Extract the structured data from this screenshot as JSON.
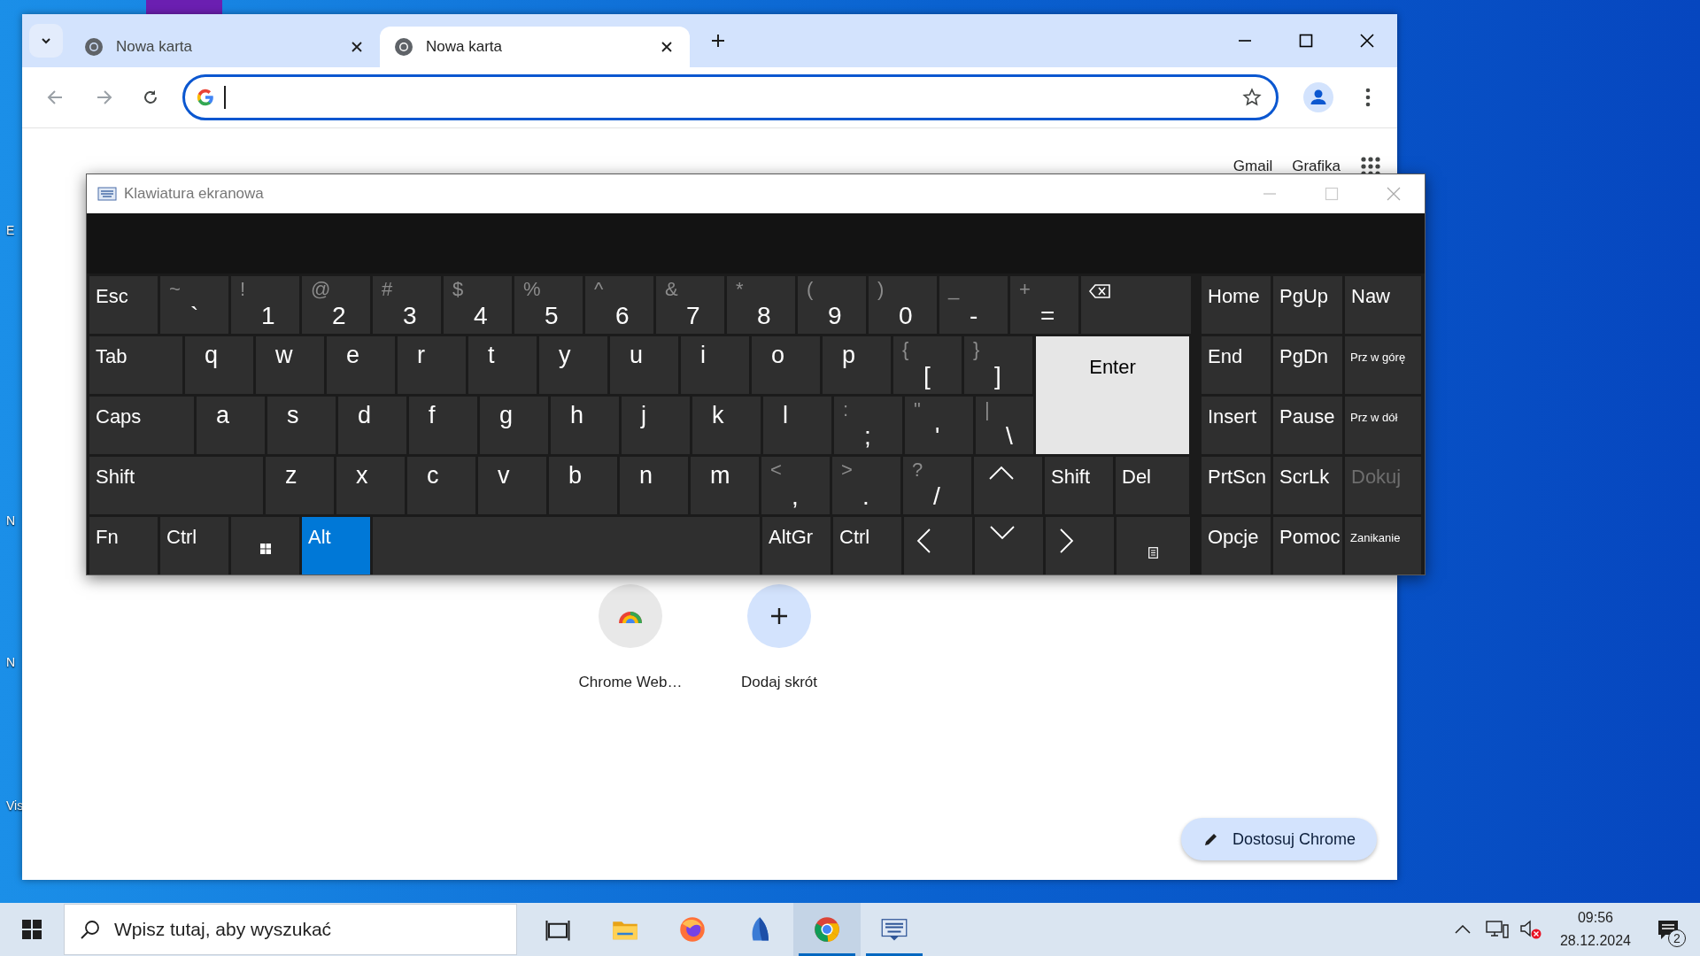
{
  "desktop": {
    "icons": [
      {
        "label": "E"
      },
      {
        "label": "N"
      },
      {
        "label": "N"
      },
      {
        "label": "Vis"
      }
    ]
  },
  "browser": {
    "tabs": [
      {
        "title": "Nowa karta",
        "selected": false
      },
      {
        "title": "Nowa karta",
        "selected": true
      }
    ],
    "header_links": [
      "Gmail",
      "Grafika"
    ],
    "shortcuts": [
      {
        "kind": "site",
        "label": "Chrome Web…"
      },
      {
        "kind": "add",
        "label": "Dodaj skrót"
      }
    ],
    "customize_button": "Dostosuj Chrome"
  },
  "keyboard": {
    "title": "Klawiatura ekranowa",
    "rows": [
      {
        "keys": [
          {
            "kind": "word",
            "label": "Esc",
            "selected": false
          },
          {
            "kind": "char",
            "shift": "~",
            "label": "`",
            "selected": false
          },
          {
            "kind": "char",
            "shift": "!",
            "label": "1",
            "selected": false
          },
          {
            "kind": "char",
            "shift": "@",
            "label": "2",
            "selected": false
          },
          {
            "kind": "char",
            "shift": "#",
            "label": "3",
            "selected": false
          },
          {
            "kind": "char",
            "shift": "$",
            "label": "4",
            "selected": false
          },
          {
            "kind": "char",
            "shift": "%",
            "label": "5",
            "selected": false
          },
          {
            "kind": "char",
            "shift": "^",
            "label": "6",
            "selected": false
          },
          {
            "kind": "char",
            "shift": "&",
            "label": "7",
            "selected": false
          },
          {
            "kind": "char",
            "shift": "*",
            "label": "8",
            "selected": false
          },
          {
            "kind": "char",
            "shift": "(",
            "label": "9",
            "selected": false
          },
          {
            "kind": "char",
            "shift": ")",
            "label": "0",
            "selected": false
          },
          {
            "kind": "char",
            "shift": "_",
            "label": "-",
            "selected": false
          },
          {
            "kind": "char",
            "shift": "+",
            "label": "=",
            "selected": false
          },
          {
            "kind": "backspace",
            "selected": false
          }
        ]
      },
      {
        "keys": [
          {
            "kind": "word",
            "label": "Tab",
            "selected": false
          },
          {
            "kind": "char",
            "label": "q",
            "selected": false
          },
          {
            "kind": "char",
            "label": "w",
            "selected": false
          },
          {
            "kind": "char",
            "label": "e",
            "selected": false
          },
          {
            "kind": "char",
            "label": "r",
            "selected": false
          },
          {
            "kind": "char",
            "label": "t",
            "selected": false
          },
          {
            "kind": "char",
            "label": "y",
            "selected": false
          },
          {
            "kind": "char",
            "label": "u",
            "selected": false
          },
          {
            "kind": "char",
            "label": "i",
            "selected": false
          },
          {
            "kind": "char",
            "label": "o",
            "selected": false
          },
          {
            "kind": "char",
            "label": "p",
            "selected": false
          },
          {
            "kind": "char",
            "shift": "{",
            "label": "[",
            "selected": false
          },
          {
            "kind": "char",
            "shift": "}",
            "label": "]",
            "selected": false
          },
          {
            "kind": "enter",
            "label": "Enter",
            "selected": true
          }
        ]
      },
      {
        "keys": [
          {
            "kind": "word",
            "label": "Caps",
            "selected": false
          },
          {
            "kind": "char",
            "label": "a",
            "selected": false
          },
          {
            "kind": "char",
            "label": "s",
            "selected": false
          },
          {
            "kind": "char",
            "label": "d",
            "selected": false
          },
          {
            "kind": "char",
            "label": "f",
            "selected": false
          },
          {
            "kind": "char",
            "label": "g",
            "selected": false
          },
          {
            "kind": "char",
            "label": "h",
            "selected": false
          },
          {
            "kind": "char",
            "label": "j",
            "selected": false
          },
          {
            "kind": "char",
            "label": "k",
            "selected": false
          },
          {
            "kind": "char",
            "label": "l",
            "selected": false
          },
          {
            "kind": "char",
            "shift": ":",
            "label": ";",
            "selected": false
          },
          {
            "kind": "char",
            "shift": "\"",
            "label": "'",
            "selected": false
          },
          {
            "kind": "char",
            "shift": "|",
            "label": "\\",
            "selected": false
          }
        ]
      },
      {
        "keys": [
          {
            "kind": "word",
            "label": "Shift",
            "selected": false
          },
          {
            "kind": "char",
            "label": "z",
            "selected": false
          },
          {
            "kind": "char",
            "label": "x",
            "selected": false
          },
          {
            "kind": "char",
            "label": "c",
            "selected": false
          },
          {
            "kind": "char",
            "label": "v",
            "selected": false
          },
          {
            "kind": "char",
            "label": "b",
            "selected": false
          },
          {
            "kind": "char",
            "label": "n",
            "selected": false
          },
          {
            "kind": "char",
            "label": "m",
            "selected": false
          },
          {
            "kind": "char",
            "shift": "<",
            "label": ",",
            "selected": false
          },
          {
            "kind": "char",
            "shift": ">",
            "label": ".",
            "selected": false
          },
          {
            "kind": "char",
            "shift": "?",
            "label": "/",
            "selected": false
          },
          {
            "kind": "up",
            "selected": false
          },
          {
            "kind": "word",
            "label": "Shift",
            "selected": false
          },
          {
            "kind": "word",
            "label": "Del",
            "selected": false
          }
        ]
      },
      {
        "keys": [
          {
            "kind": "word",
            "label": "Fn",
            "selected": false
          },
          {
            "kind": "word",
            "label": "Ctrl",
            "selected": false
          },
          {
            "kind": "windows",
            "selected": false
          },
          {
            "kind": "word",
            "label": "Alt",
            "selected": true
          },
          {
            "kind": "space",
            "selected": false
          },
          {
            "kind": "word",
            "label": "AltGr",
            "selected": false
          },
          {
            "kind": "word",
            "label": "Ctrl",
            "selected": false
          },
          {
            "kind": "left",
            "selected": false
          },
          {
            "kind": "down",
            "selected": false
          },
          {
            "kind": "right",
            "selected": false
          },
          {
            "kind": "menu",
            "selected": false
          }
        ]
      }
    ],
    "side_rows": [
      {
        "keys": [
          {
            "kind": "word",
            "label": "Home",
            "disabled": false
          },
          {
            "kind": "word",
            "label": "PgUp",
            "disabled": false
          },
          {
            "kind": "word",
            "label": "Naw",
            "disabled": false
          }
        ]
      },
      {
        "keys": [
          {
            "kind": "word",
            "label": "End",
            "disabled": false
          },
          {
            "kind": "word",
            "label": "PgDn",
            "disabled": false
          },
          {
            "kind": "small",
            "label": "Prz w górę",
            "disabled": false
          }
        ]
      },
      {
        "keys": [
          {
            "kind": "word",
            "label": "Insert",
            "disabled": false
          },
          {
            "kind": "word",
            "label": "Pause",
            "disabled": false
          },
          {
            "kind": "small",
            "label": "Prz w dół",
            "disabled": false
          }
        ]
      },
      {
        "keys": [
          {
            "kind": "word",
            "label": "PrtScn",
            "disabled": false
          },
          {
            "kind": "word",
            "label": "ScrLk",
            "disabled": false
          },
          {
            "kind": "word",
            "label": "Dokuj",
            "disabled": true
          }
        ]
      },
      {
        "keys": [
          {
            "kind": "word",
            "label": "Opcje",
            "disabled": false
          },
          {
            "kind": "word",
            "label": "Pomoc",
            "disabled": false
          },
          {
            "kind": "small",
            "label": "Zanikanie",
            "disabled": false
          }
        ]
      }
    ]
  },
  "taskbar": {
    "search": {
      "placeholder": "Wpisz tutaj, aby wyszukać"
    },
    "apps": [
      {
        "kind": "taskview",
        "running": false,
        "selected": false
      },
      {
        "kind": "folder",
        "running": false,
        "selected": false
      },
      {
        "kind": "firefox",
        "running": false,
        "selected": false
      },
      {
        "kind": "sail",
        "running": false,
        "selected": false
      },
      {
        "kind": "chrome",
        "running": true,
        "selected": true
      },
      {
        "kind": "keyboard",
        "running": true,
        "selected": false
      }
    ],
    "time": "09:56",
    "date": "28.12.2024",
    "notifications": "2"
  }
}
